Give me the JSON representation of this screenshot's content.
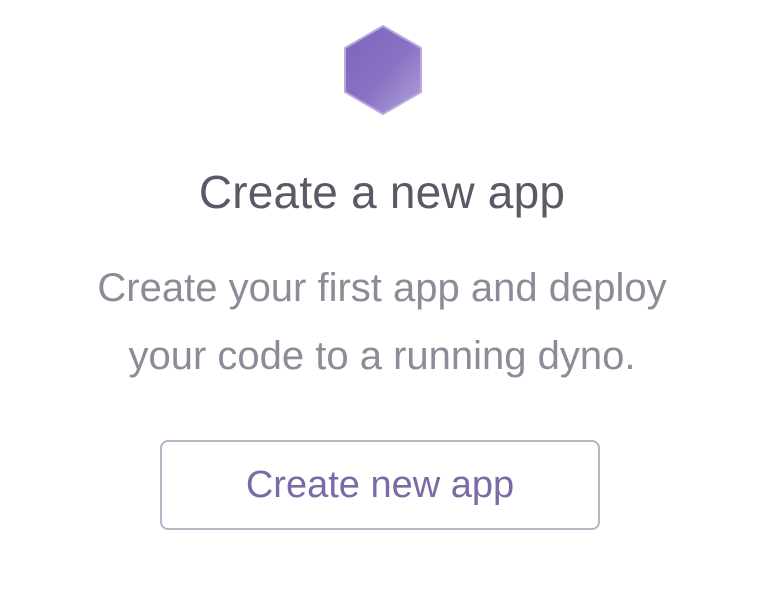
{
  "empty_state": {
    "icon": "hexagon-icon",
    "accent_color": "#8a73c4",
    "title": "Create a new app",
    "description_line_1": "Create your first app and deploy",
    "description_line_2": "your code to a running dyno.",
    "button_label": "Create new app"
  }
}
